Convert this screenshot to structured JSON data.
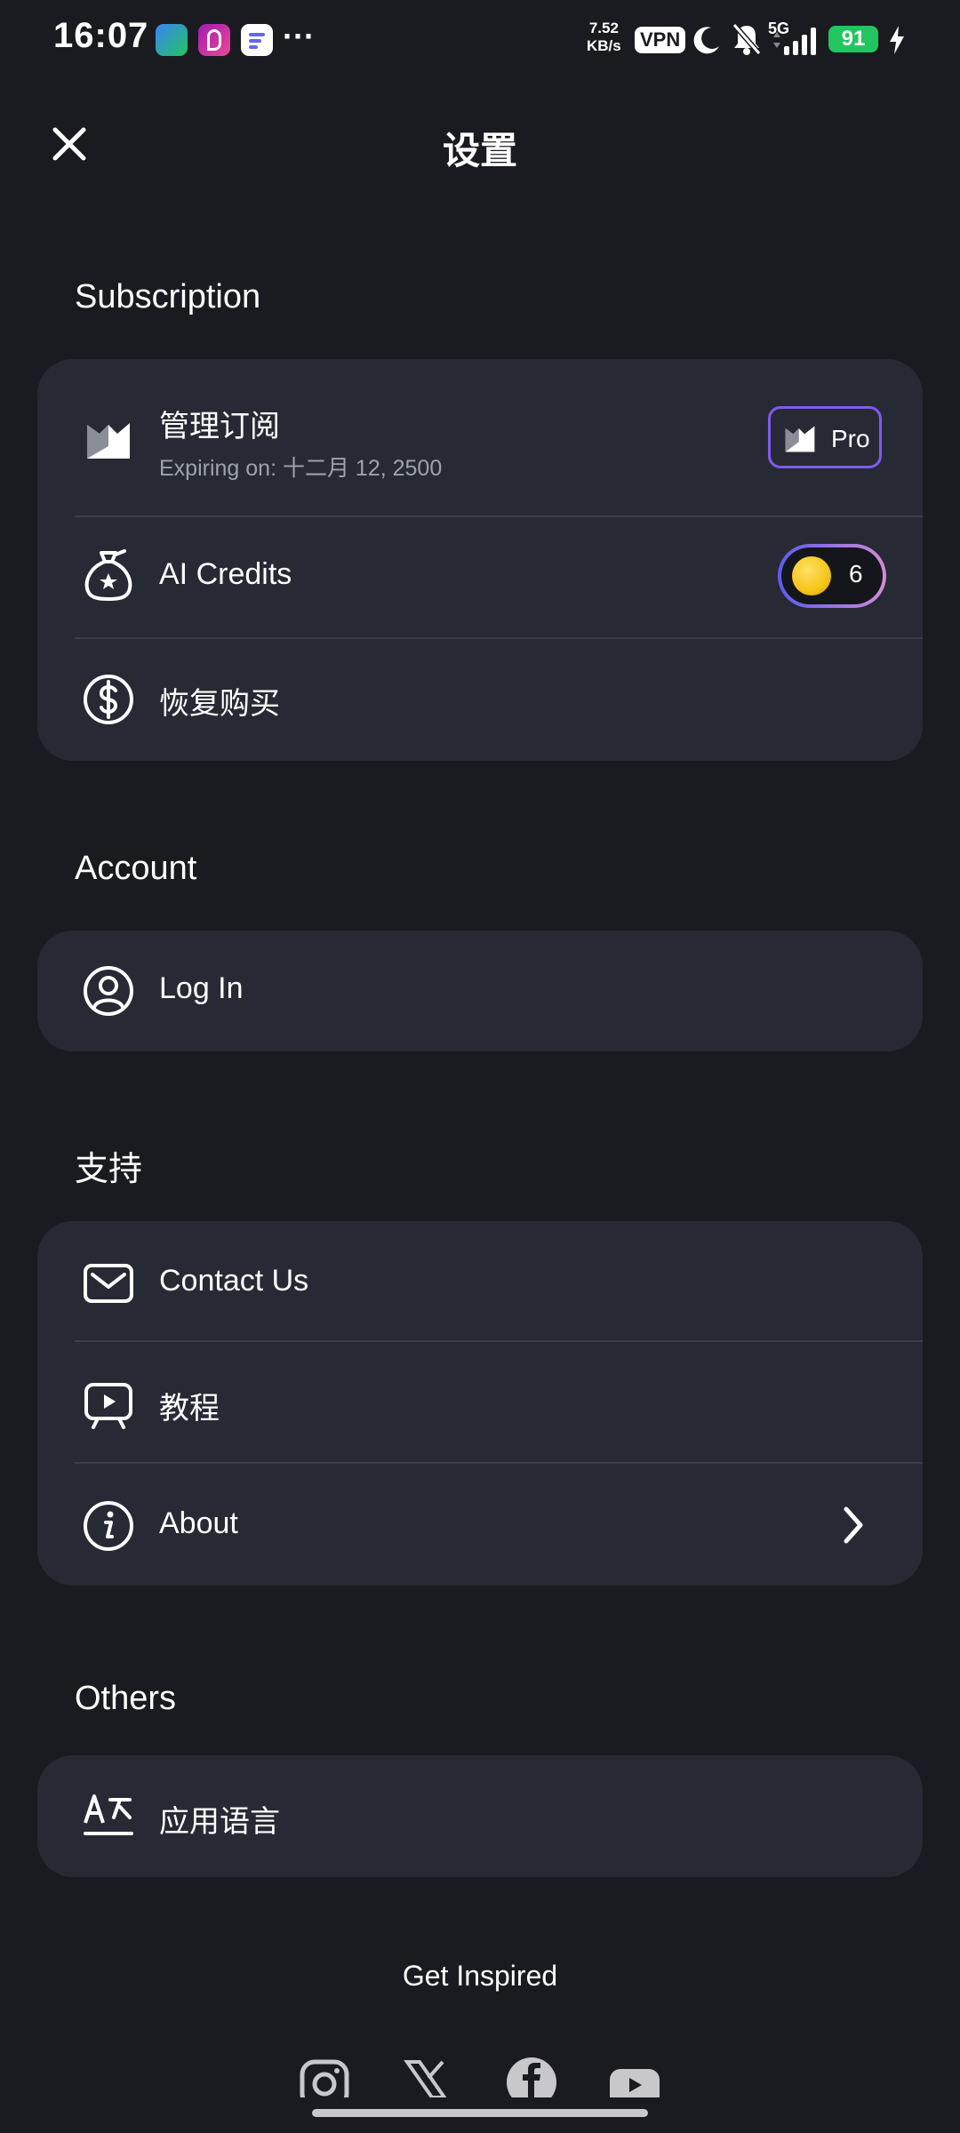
{
  "status_bar": {
    "time": "16:07",
    "dots": "···",
    "net_speed_value": "7.52",
    "net_speed_unit": "KB/s",
    "vpn": "VPN",
    "network": "5G",
    "battery": "91"
  },
  "header": {
    "title": "设置",
    "close_icon": "close-icon"
  },
  "sections": {
    "subscription": {
      "heading": "Subscription",
      "manage_label": "管理订阅",
      "expiry": "Expiring on: 十二月 12, 2500",
      "pro_badge": "Pro",
      "ai_credits_label": "AI Credits",
      "ai_credits_value": "6",
      "restore_label": "恢复购买"
    },
    "account": {
      "heading": "Account",
      "login_label": "Log In"
    },
    "support": {
      "heading": "支持",
      "contact_label": "Contact Us",
      "tutorial_label": "教程",
      "about_label": "About"
    },
    "others": {
      "heading": "Others",
      "language_label": "应用语言"
    }
  },
  "footer": {
    "title": "Get Inspired",
    "social": [
      "instagram-icon",
      "x-icon",
      "facebook-icon",
      "youtube-icon"
    ]
  },
  "colors": {
    "background": "#1a1b20",
    "card": "#272a34",
    "accent": "#7f5af0",
    "battery": "#22c55e",
    "coin": "#f5c518"
  }
}
